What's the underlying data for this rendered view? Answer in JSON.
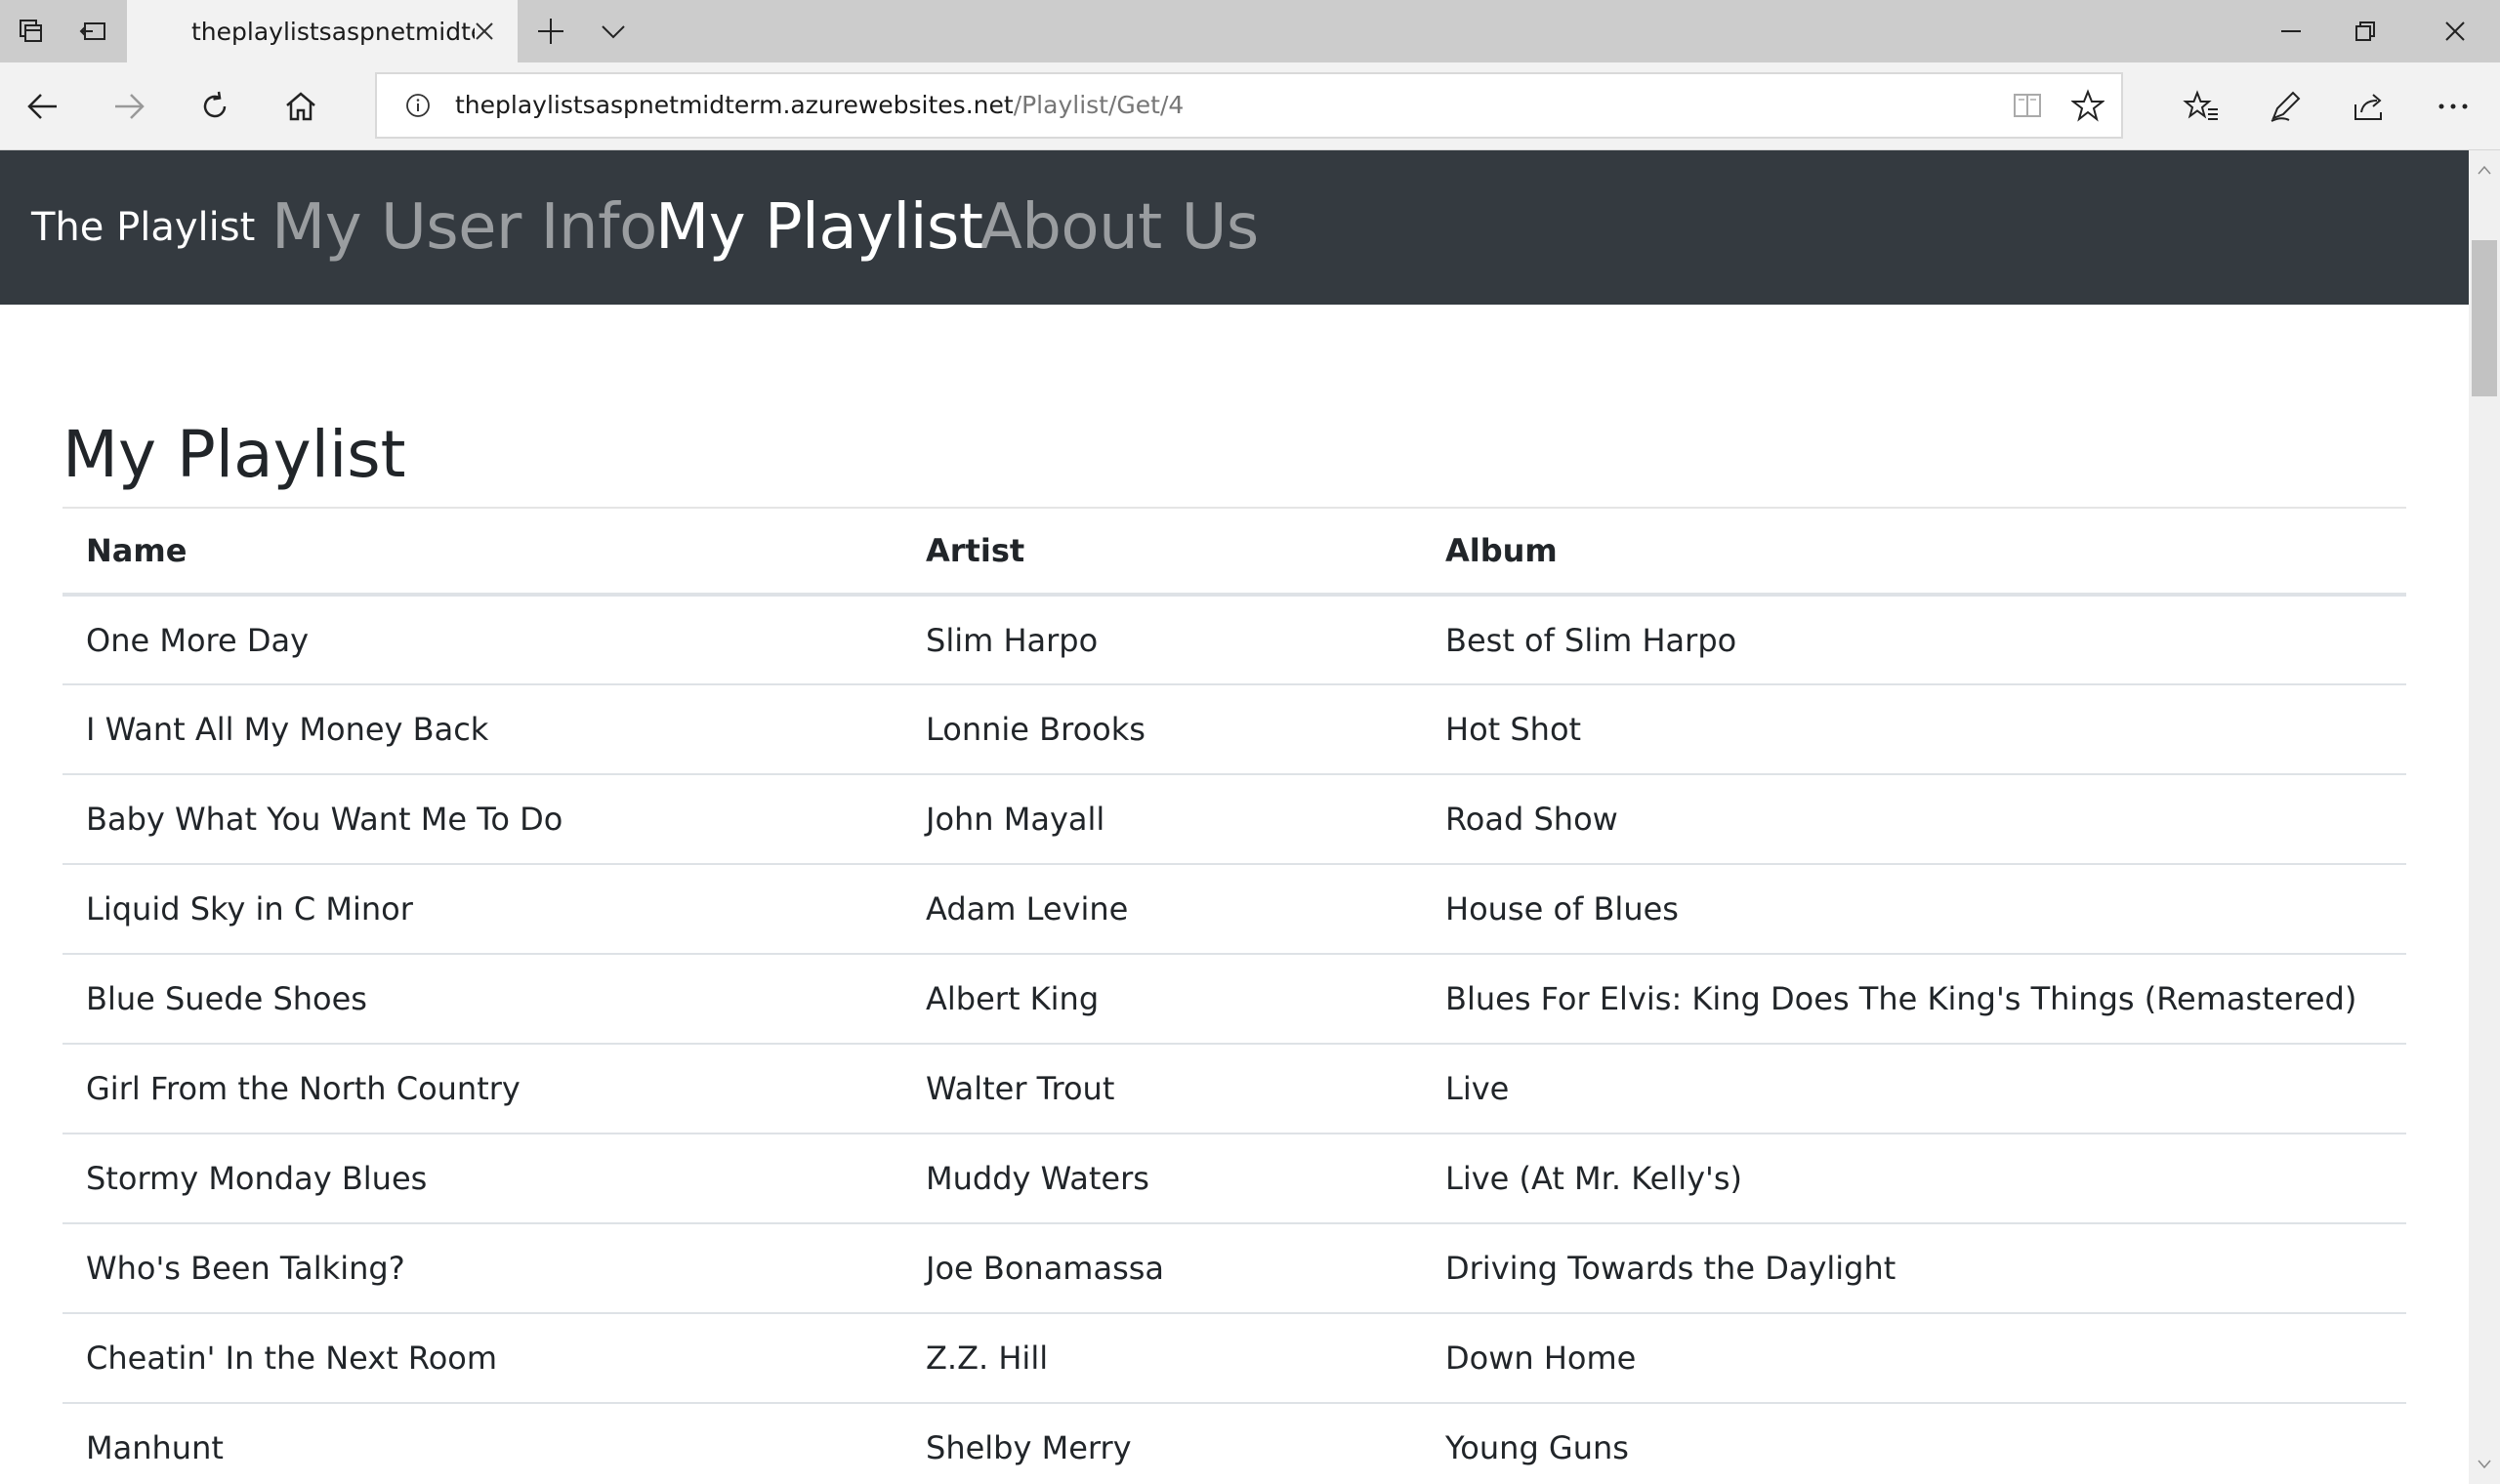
{
  "browser": {
    "tab_title": "theplaylistsaspnetmidte",
    "url_host": "theplaylistsaspnetmidterm.azurewebsites.net",
    "url_path": "/Playlist/Get/4"
  },
  "site": {
    "brand": "The Playlist",
    "nav": [
      {
        "label": "My User Info",
        "active": false
      },
      {
        "label": "My Playlist",
        "active": true
      },
      {
        "label": "About Us",
        "active": false
      }
    ]
  },
  "main": {
    "title": "My Playlist",
    "columns": [
      "Name",
      "Artist",
      "Album"
    ],
    "rows": [
      [
        "One More Day",
        "Slim Harpo",
        "Best of Slim Harpo"
      ],
      [
        "I Want All My Money Back",
        "Lonnie Brooks",
        "Hot Shot"
      ],
      [
        "Baby What You Want Me To Do",
        "John Mayall",
        "Road Show"
      ],
      [
        "Liquid Sky in C Minor",
        "Adam Levine",
        "House of Blues"
      ],
      [
        "Blue Suede Shoes",
        "Albert King",
        "Blues For Elvis: King Does The King's Things (Remastered)"
      ],
      [
        "Girl From the North Country",
        "Walter Trout",
        "Live"
      ],
      [
        "Stormy Monday Blues",
        "Muddy Waters",
        "Live (At Mr. Kelly's)"
      ],
      [
        "Who's Been Talking?",
        "Joe Bonamassa",
        "Driving Towards the Daylight"
      ],
      [
        "Cheatin' In the Next Room",
        "Z.Z. Hill",
        "Down Home"
      ],
      [
        "Manhunt",
        "Shelby Merry",
        "Young Guns"
      ]
    ]
  },
  "colors": {
    "navbar_bg": "#343a40",
    "chrome_bg": "#cccccc",
    "toolbar_bg": "#f2f2f2"
  },
  "icons": {
    "tabbar": [
      "tab-preview-icon",
      "set-aside-tabs-icon",
      "new-tab-icon",
      "tab-list-chevron-icon"
    ],
    "window": [
      "minimize-icon",
      "restore-icon",
      "close-window-icon"
    ],
    "toolbar": [
      "back-icon",
      "forward-icon",
      "refresh-icon",
      "home-icon",
      "site-info-icon",
      "reading-view-icon",
      "favorite-star-icon",
      "favorites-list-icon",
      "web-note-pen-icon",
      "share-icon",
      "more-dots-icon"
    ]
  }
}
